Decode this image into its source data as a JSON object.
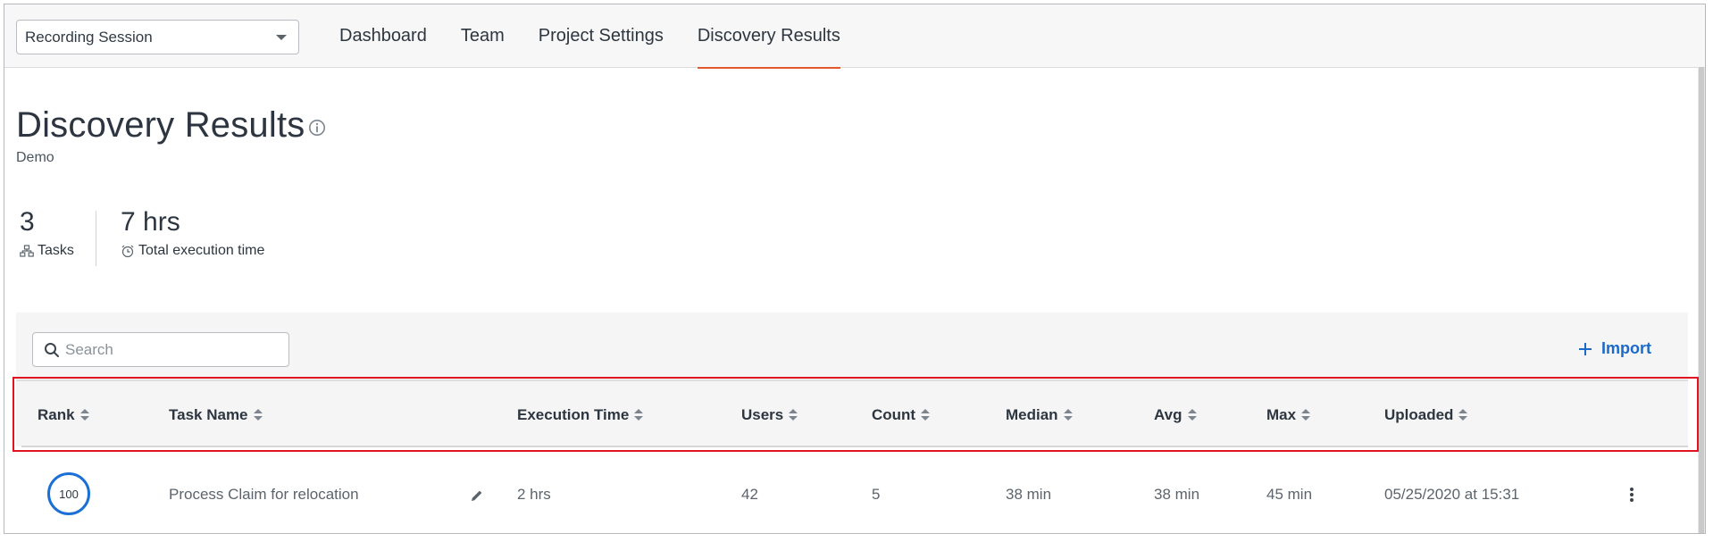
{
  "nav": {
    "project_select": {
      "value": "Recording Session"
    },
    "tabs": [
      {
        "label": "Dashboard",
        "active": false
      },
      {
        "label": "Team",
        "active": false
      },
      {
        "label": "Project Settings",
        "active": false
      },
      {
        "label": "Discovery Results",
        "active": true
      }
    ]
  },
  "header": {
    "title": "Discovery Results",
    "subtitle": "Demo",
    "info_icon": "info-circle-icon"
  },
  "stats": [
    {
      "value": "3",
      "label": "Tasks",
      "icon": "tasks-icon"
    },
    {
      "value": "7 hrs",
      "label": "Total execution time",
      "icon": "alarm-clock-icon"
    }
  ],
  "toolbar": {
    "search_placeholder": "Search",
    "import_label": "Import",
    "import_icon": "plus-icon"
  },
  "table": {
    "columns": [
      "Rank",
      "Task Name",
      "Execution Time",
      "Users",
      "Count",
      "Median",
      "Avg",
      "Max",
      "Uploaded"
    ],
    "rows": [
      {
        "rank": "100",
        "task_name": "Process Claim for relocation",
        "execution_time": "2 hrs",
        "users": "42",
        "count": "5",
        "median": "38 min",
        "avg": "38 min",
        "max": "45 min",
        "uploaded": "05/25/2020 at 15:31"
      }
    ]
  },
  "colors": {
    "accent_tab": "#e05a2b",
    "link": "#1b6ac9",
    "rank_ring": "#1a70d4",
    "highlight": "#e0141e"
  }
}
